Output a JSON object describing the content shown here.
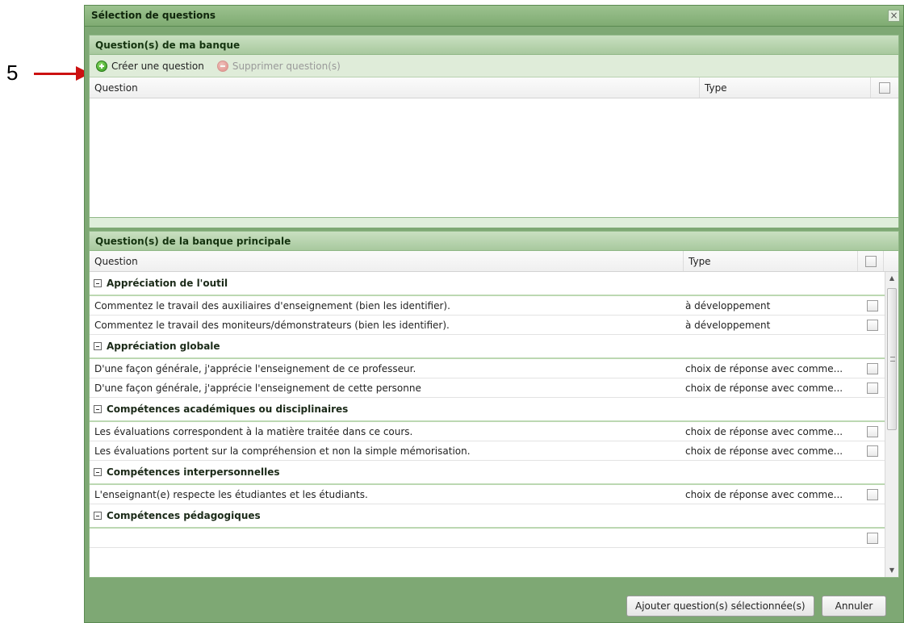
{
  "annotation": {
    "number": "5"
  },
  "window": {
    "title": "Sélection de questions",
    "close_glyph": "×"
  },
  "my_bank": {
    "header": "Question(s) de ma banque",
    "toolbar": {
      "create_label": "Créer une question",
      "delete_label": "Supprimer question(s)"
    },
    "columns": {
      "question": "Question",
      "type": "Type"
    }
  },
  "main_bank": {
    "header": "Question(s) de la banque principale",
    "columns": {
      "question": "Question",
      "type": "Type"
    },
    "groups": [
      {
        "name": "Appréciation de l'outil",
        "rows": [
          {
            "question": "Commentez le travail des auxiliaires d'enseignement (bien les identifier).",
            "type": "à développement"
          },
          {
            "question": "Commentez le travail des moniteurs/démonstrateurs (bien les identifier).",
            "type": "à développement"
          }
        ]
      },
      {
        "name": "Appréciation globale",
        "rows": [
          {
            "question": "D'une façon générale, j'apprécie l'enseignement de ce professeur.",
            "type": "choix de réponse avec comme..."
          },
          {
            "question": "D'une façon générale, j'apprécie l'enseignement de cette personne",
            "type": "choix de réponse avec comme..."
          }
        ]
      },
      {
        "name": "Compétences académiques ou disciplinaires",
        "rows": [
          {
            "question": "Les évaluations correspondent à la matière traitée dans ce cours.",
            "type": "choix de réponse avec comme..."
          },
          {
            "question": "Les évaluations portent sur la compréhension et non la simple mémorisation.",
            "type": "choix de réponse avec comme..."
          }
        ]
      },
      {
        "name": "Compétences interpersonnelles",
        "rows": [
          {
            "question": "L'enseignant(e) respecte les étudiantes et les étudiants.",
            "type": "choix de réponse avec comme..."
          }
        ]
      },
      {
        "name": "Compétences pédagogiques",
        "rows": []
      }
    ]
  },
  "footer": {
    "add_label": "Ajouter question(s) sélectionnée(s)",
    "cancel_label": "Annuler"
  }
}
